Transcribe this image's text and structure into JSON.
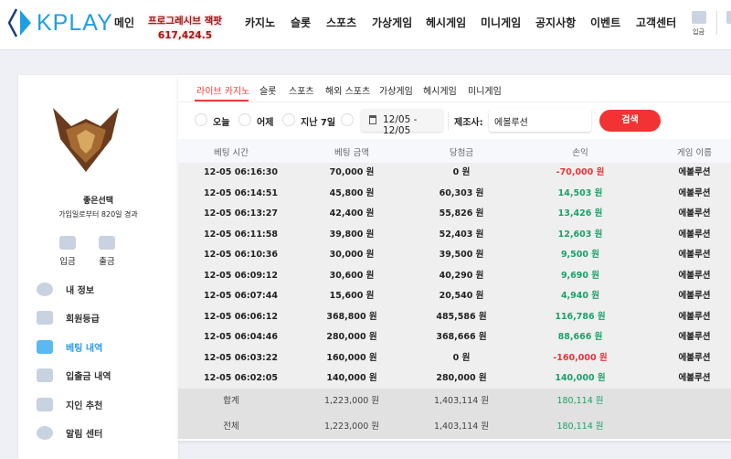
{
  "header": {
    "logo": "KPLAY",
    "nav": [
      "메인",
      "카지노",
      "슬롯",
      "스포츠",
      "가상게임",
      "헤시게임",
      "미니게임",
      "공지사항",
      "이벤트",
      "고객센터"
    ],
    "jackpot_label": "프로그레시브 잭팟",
    "jackpot_value": "617,424.5",
    "deposit_label": "입금",
    "accent": "#1f9fe0"
  },
  "sidebar": {
    "username": "좋은선택",
    "joined": "가입일로부터 820일 경과",
    "deposit": "입금",
    "withdraw": "출금",
    "menu": [
      {
        "label": "내 정보",
        "icon": "user-icon"
      },
      {
        "label": "회원등급",
        "icon": "badge-icon"
      },
      {
        "label": "베팅 내역",
        "icon": "document-icon",
        "active": true
      },
      {
        "label": "입출금 내역",
        "icon": "wallet-icon"
      },
      {
        "label": "지인 추천",
        "icon": "heart-icon"
      },
      {
        "label": "알림 센터",
        "icon": "chat-icon"
      }
    ]
  },
  "main": {
    "tabs": [
      "라이브 카지노",
      "슬롯",
      "스포츠",
      "해외 스포츠",
      "가상게임",
      "헤시게임",
      "미니게임"
    ],
    "active_tab": 0,
    "filters": [
      "오늘",
      "어제",
      "지난 7일"
    ],
    "date_range": "12/05 - 12/05",
    "maker_label": "제조사:",
    "maker_value": "에볼루션",
    "search": "검색",
    "columns": [
      "베팅 시간",
      "베팅 금액",
      "당첨금",
      "손익",
      "게임 이름"
    ],
    "rows": [
      [
        "12-05 06:16:30",
        "70,000 원",
        "0 원",
        "-70,000 원",
        "에볼루션"
      ],
      [
        "12-05 06:14:51",
        "45,800 원",
        "60,303 원",
        "14,503 원",
        "에볼루션"
      ],
      [
        "12-05 06:13:27",
        "42,400 원",
        "55,826 원",
        "13,426 원",
        "에볼루션"
      ],
      [
        "12-05 06:11:58",
        "39,800 원",
        "52,403 원",
        "12,603 원",
        "에볼루션"
      ],
      [
        "12-05 06:10:36",
        "30,000 원",
        "39,500 원",
        "9,500 원",
        "에볼루션"
      ],
      [
        "12-05 06:09:12",
        "30,600 원",
        "40,290 원",
        "9,690 원",
        "에볼루션"
      ],
      [
        "12-05 06:07:44",
        "15,600 원",
        "20,540 원",
        "4,940 원",
        "에볼루션"
      ],
      [
        "12-05 06:06:12",
        "368,800 원",
        "485,586 원",
        "116,786 원",
        "에볼루션"
      ],
      [
        "12-05 06:04:46",
        "280,000 원",
        "368,666 원",
        "88,666 원",
        "에볼루션"
      ],
      [
        "12-05 06:03:22",
        "160,000 원",
        "0 원",
        "-160,000 원",
        "에볼루션"
      ],
      [
        "12-05 06:02:05",
        "140,000 원",
        "280,000 원",
        "140,000 원",
        "에볼루션"
      ]
    ],
    "summary": [
      [
        "합계",
        "1,223,000 원",
        "1,403,114 원",
        "180,114 원"
      ],
      [
        "전체",
        "1,223,000 원",
        "1,403,114 원",
        "180,114 원"
      ]
    ],
    "colors": {
      "positive": "#1aa26a",
      "negative": "#e8343a",
      "accent": "#f03a3a"
    }
  }
}
